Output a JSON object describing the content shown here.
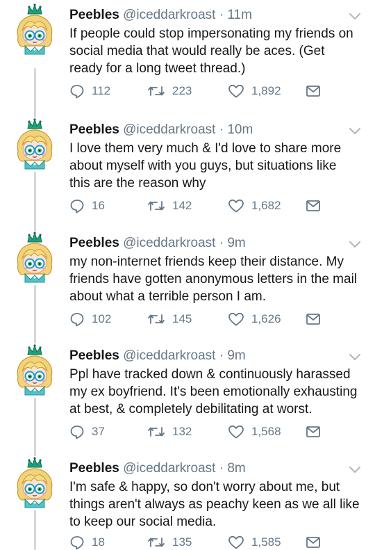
{
  "colors": {
    "text": "#14171a",
    "muted": "#657786",
    "thread_line": "#d2d8dc",
    "icon": "#657786"
  },
  "icons": {
    "reply": "reply-bubble-icon",
    "retweet": "retweet-arrows-icon",
    "like": "heart-icon",
    "dm": "envelope-icon",
    "menu": "chevron-down-icon"
  },
  "tweets": [
    {
      "name": "Peebles",
      "handle": "@iceddarkroast",
      "separator": "·",
      "time": "11m",
      "text": "If people could stop impersonating my friends on social media that would really be aces. (Get ready for a long tweet thread.)",
      "replies": "112",
      "retweets": "223",
      "likes": "1,892"
    },
    {
      "name": "Peebles",
      "handle": "@iceddarkroast",
      "separator": "·",
      "time": "10m",
      "text": "I love them very much & I'd love to share more about myself with you guys, but situations like this are the reason why",
      "replies": "16",
      "retweets": "142",
      "likes": "1,682"
    },
    {
      "name": "Peebles",
      "handle": "@iceddarkroast",
      "separator": "·",
      "time": "9m",
      "text": "my non-internet friends keep their distance. My friends have gotten anonymous letters in the mail about what a terrible person I am.",
      "replies": "102",
      "retweets": "145",
      "likes": "1,626"
    },
    {
      "name": "Peebles",
      "handle": "@iceddarkroast",
      "separator": "·",
      "time": "9m",
      "text": "Ppl have tracked down & continuously harassed my ex boyfriend. It's been emotionally exhausting at best, & completely debilitating at worst.",
      "replies": "37",
      "retweets": "132",
      "likes": "1,568"
    },
    {
      "name": "Peebles",
      "handle": "@iceddarkroast",
      "separator": "·",
      "time": "8m",
      "text": "I'm safe & happy, so don't worry about me, but things aren't always as peachy keen as we all like to keep our social media.",
      "replies": "18",
      "retweets": "135",
      "likes": "1,585"
    }
  ]
}
